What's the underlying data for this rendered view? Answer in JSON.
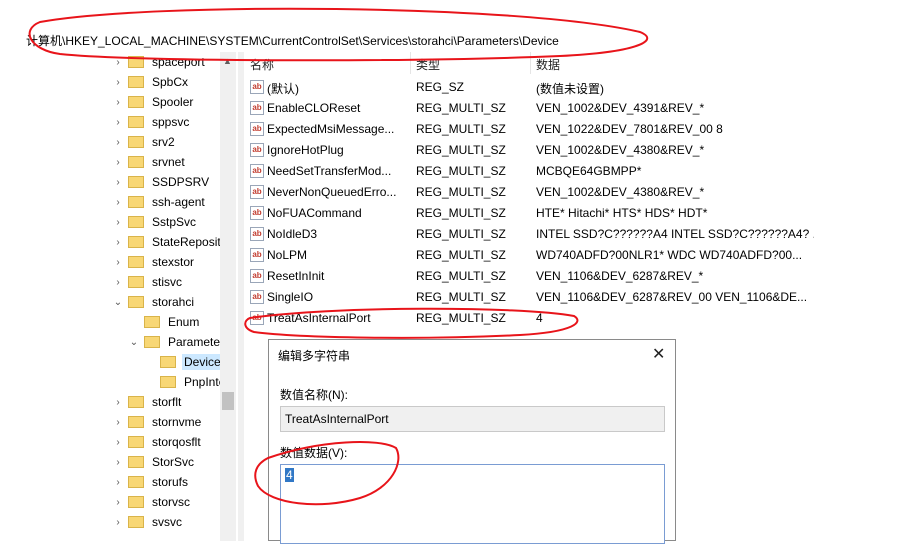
{
  "address": {
    "path": "计算机\\HKEY_LOCAL_MACHINE\\SYSTEM\\CurrentControlSet\\Services\\storahci\\Parameters\\Device"
  },
  "tree": {
    "items": [
      {
        "label": "spaceport"
      },
      {
        "label": "SpbCx"
      },
      {
        "label": "Spooler"
      },
      {
        "label": "sppsvc"
      },
      {
        "label": "srv2"
      },
      {
        "label": "srvnet"
      },
      {
        "label": "SSDPSRV"
      },
      {
        "label": "ssh-agent"
      },
      {
        "label": "SstpSvc"
      },
      {
        "label": "StateReposit"
      },
      {
        "label": "stexstor"
      },
      {
        "label": "stisvc"
      },
      {
        "label": "storahci"
      },
      {
        "label": "Enum"
      },
      {
        "label": "Parameter"
      },
      {
        "label": "Device"
      },
      {
        "label": "PnpInte"
      },
      {
        "label": "storflt"
      },
      {
        "label": "stornvme"
      },
      {
        "label": "storqosflt"
      },
      {
        "label": "StorSvc"
      },
      {
        "label": "storufs"
      },
      {
        "label": "storvsc"
      },
      {
        "label": "svsvc"
      }
    ]
  },
  "list": {
    "columns": {
      "name": "名称",
      "type": "类型",
      "data": "数据"
    },
    "rows": [
      {
        "name": "(默认)",
        "type": "REG_SZ",
        "data": "(数值未设置)"
      },
      {
        "name": "EnableCLOReset",
        "type": "REG_MULTI_SZ",
        "data": "VEN_1002&DEV_4391&REV_*"
      },
      {
        "name": "ExpectedMsiMessage...",
        "type": "REG_MULTI_SZ",
        "data": "VEN_1022&DEV_7801&REV_00 8"
      },
      {
        "name": "IgnoreHotPlug",
        "type": "REG_MULTI_SZ",
        "data": "VEN_1002&DEV_4380&REV_*"
      },
      {
        "name": "NeedSetTransferMod...",
        "type": "REG_MULTI_SZ",
        "data": "MCBQE64GBMPP*"
      },
      {
        "name": "NeverNonQueuedErro...",
        "type": "REG_MULTI_SZ",
        "data": "VEN_1002&DEV_4380&REV_*"
      },
      {
        "name": "NoFUACommand",
        "type": "REG_MULTI_SZ",
        "data": "HTE* Hitachi* HTS* HDS* HDT*"
      },
      {
        "name": "NoIdleD3",
        "type": "REG_MULTI_SZ",
        "data": "INTEL SSD?C??????A4 INTEL SSD?C??????A4? ..."
      },
      {
        "name": "NoLPM",
        "type": "REG_MULTI_SZ",
        "data": "WD740ADFD?00NLR1* WDC WD740ADFD?00..."
      },
      {
        "name": "ResetInInit",
        "type": "REG_MULTI_SZ",
        "data": "VEN_1106&DEV_6287&REV_*"
      },
      {
        "name": "SingleIO",
        "type": "REG_MULTI_SZ",
        "data": "VEN_1106&DEV_6287&REV_00 VEN_1106&DE..."
      },
      {
        "name": "TreatAsInternalPort",
        "type": "REG_MULTI_SZ",
        "data": "4"
      }
    ],
    "icon_text": "ab"
  },
  "dialog": {
    "title": "编辑多字符串",
    "name_label": "数值名称(N):",
    "name_value": "TreatAsInternalPort",
    "data_label": "数值数据(V):",
    "data_value": "4",
    "close_glyph": "✕"
  }
}
